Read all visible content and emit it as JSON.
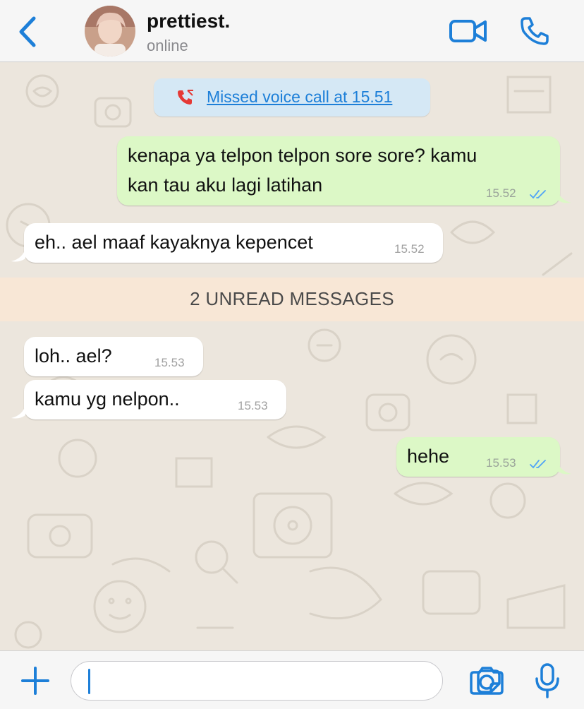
{
  "header": {
    "contact_name": "prettiest.",
    "status": "online"
  },
  "system": {
    "missed_call_text": "Missed voice call at 15.51"
  },
  "messages": [
    {
      "direction": "out",
      "lines": [
        "kenapa ya telpon telpon sore sore? kamu",
        "kan tau aku lagi latihan"
      ],
      "time": "15.52",
      "read": true
    },
    {
      "direction": "in",
      "lines": [
        "eh.. ael maaf kayaknya kepencet"
      ],
      "time": "15.52"
    },
    {
      "direction": "in",
      "lines": [
        "loh.. ael?"
      ],
      "time": "15.53"
    },
    {
      "direction": "in",
      "lines": [
        "kamu yg nelpon.."
      ],
      "time": "15.53"
    },
    {
      "direction": "out",
      "lines": [
        "hehe"
      ],
      "time": "15.53",
      "read": true
    }
  ],
  "unread_divider": "2 UNREAD MESSAGES",
  "input": {
    "value": "",
    "placeholder": ""
  },
  "colors": {
    "accent": "#1d7fd8",
    "outgoing_bubble": "#dcf8c6",
    "incoming_bubble": "#ffffff",
    "unread_bar": "#f8e7d6",
    "missed_call_icon": "#e53935",
    "read_ticks": "#4fa3f7"
  },
  "icons": {
    "back": "chevron-left-icon",
    "video_call": "video-camera-icon",
    "voice_call": "phone-icon",
    "missed_call": "missed-call-icon",
    "attach": "plus-icon",
    "sticker": "sticker-icon",
    "camera": "camera-icon",
    "microphone": "microphone-icon"
  }
}
